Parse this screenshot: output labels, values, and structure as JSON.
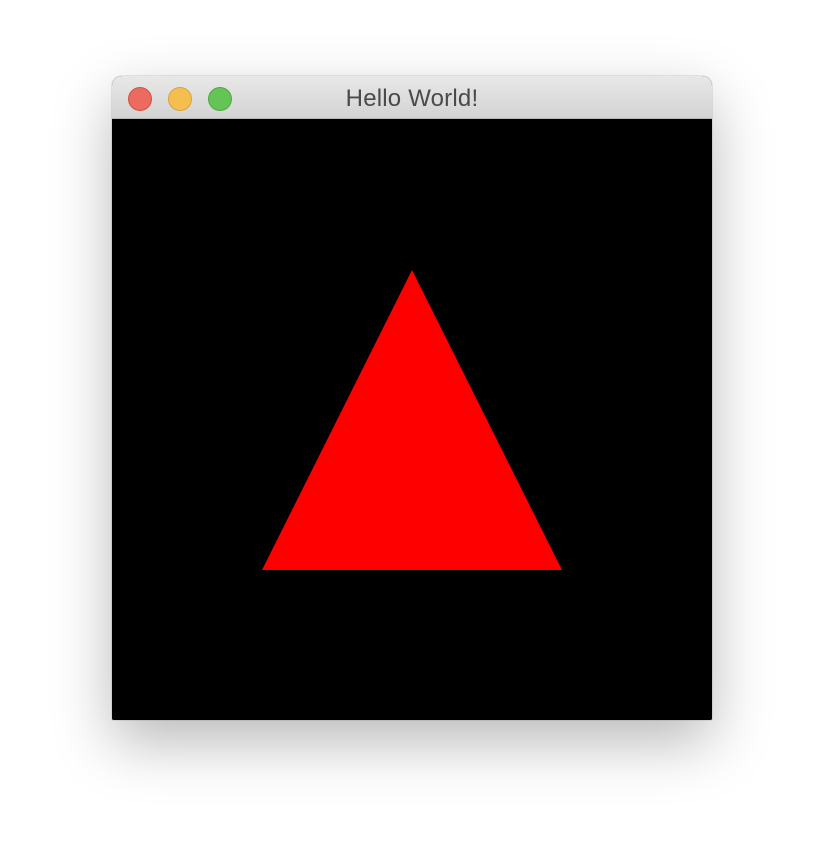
{
  "window": {
    "title": "Hello World!",
    "controls": {
      "close": {
        "icon": "close-icon",
        "color": "#ED6A5E"
      },
      "minimize": {
        "icon": "minimize-icon",
        "color": "#F5BF4F"
      },
      "zoom": {
        "icon": "zoom-icon",
        "color": "#62C554"
      }
    }
  },
  "canvas": {
    "background_color": "#000000",
    "shape": {
      "type": "triangle",
      "color": "#FF0000"
    }
  }
}
